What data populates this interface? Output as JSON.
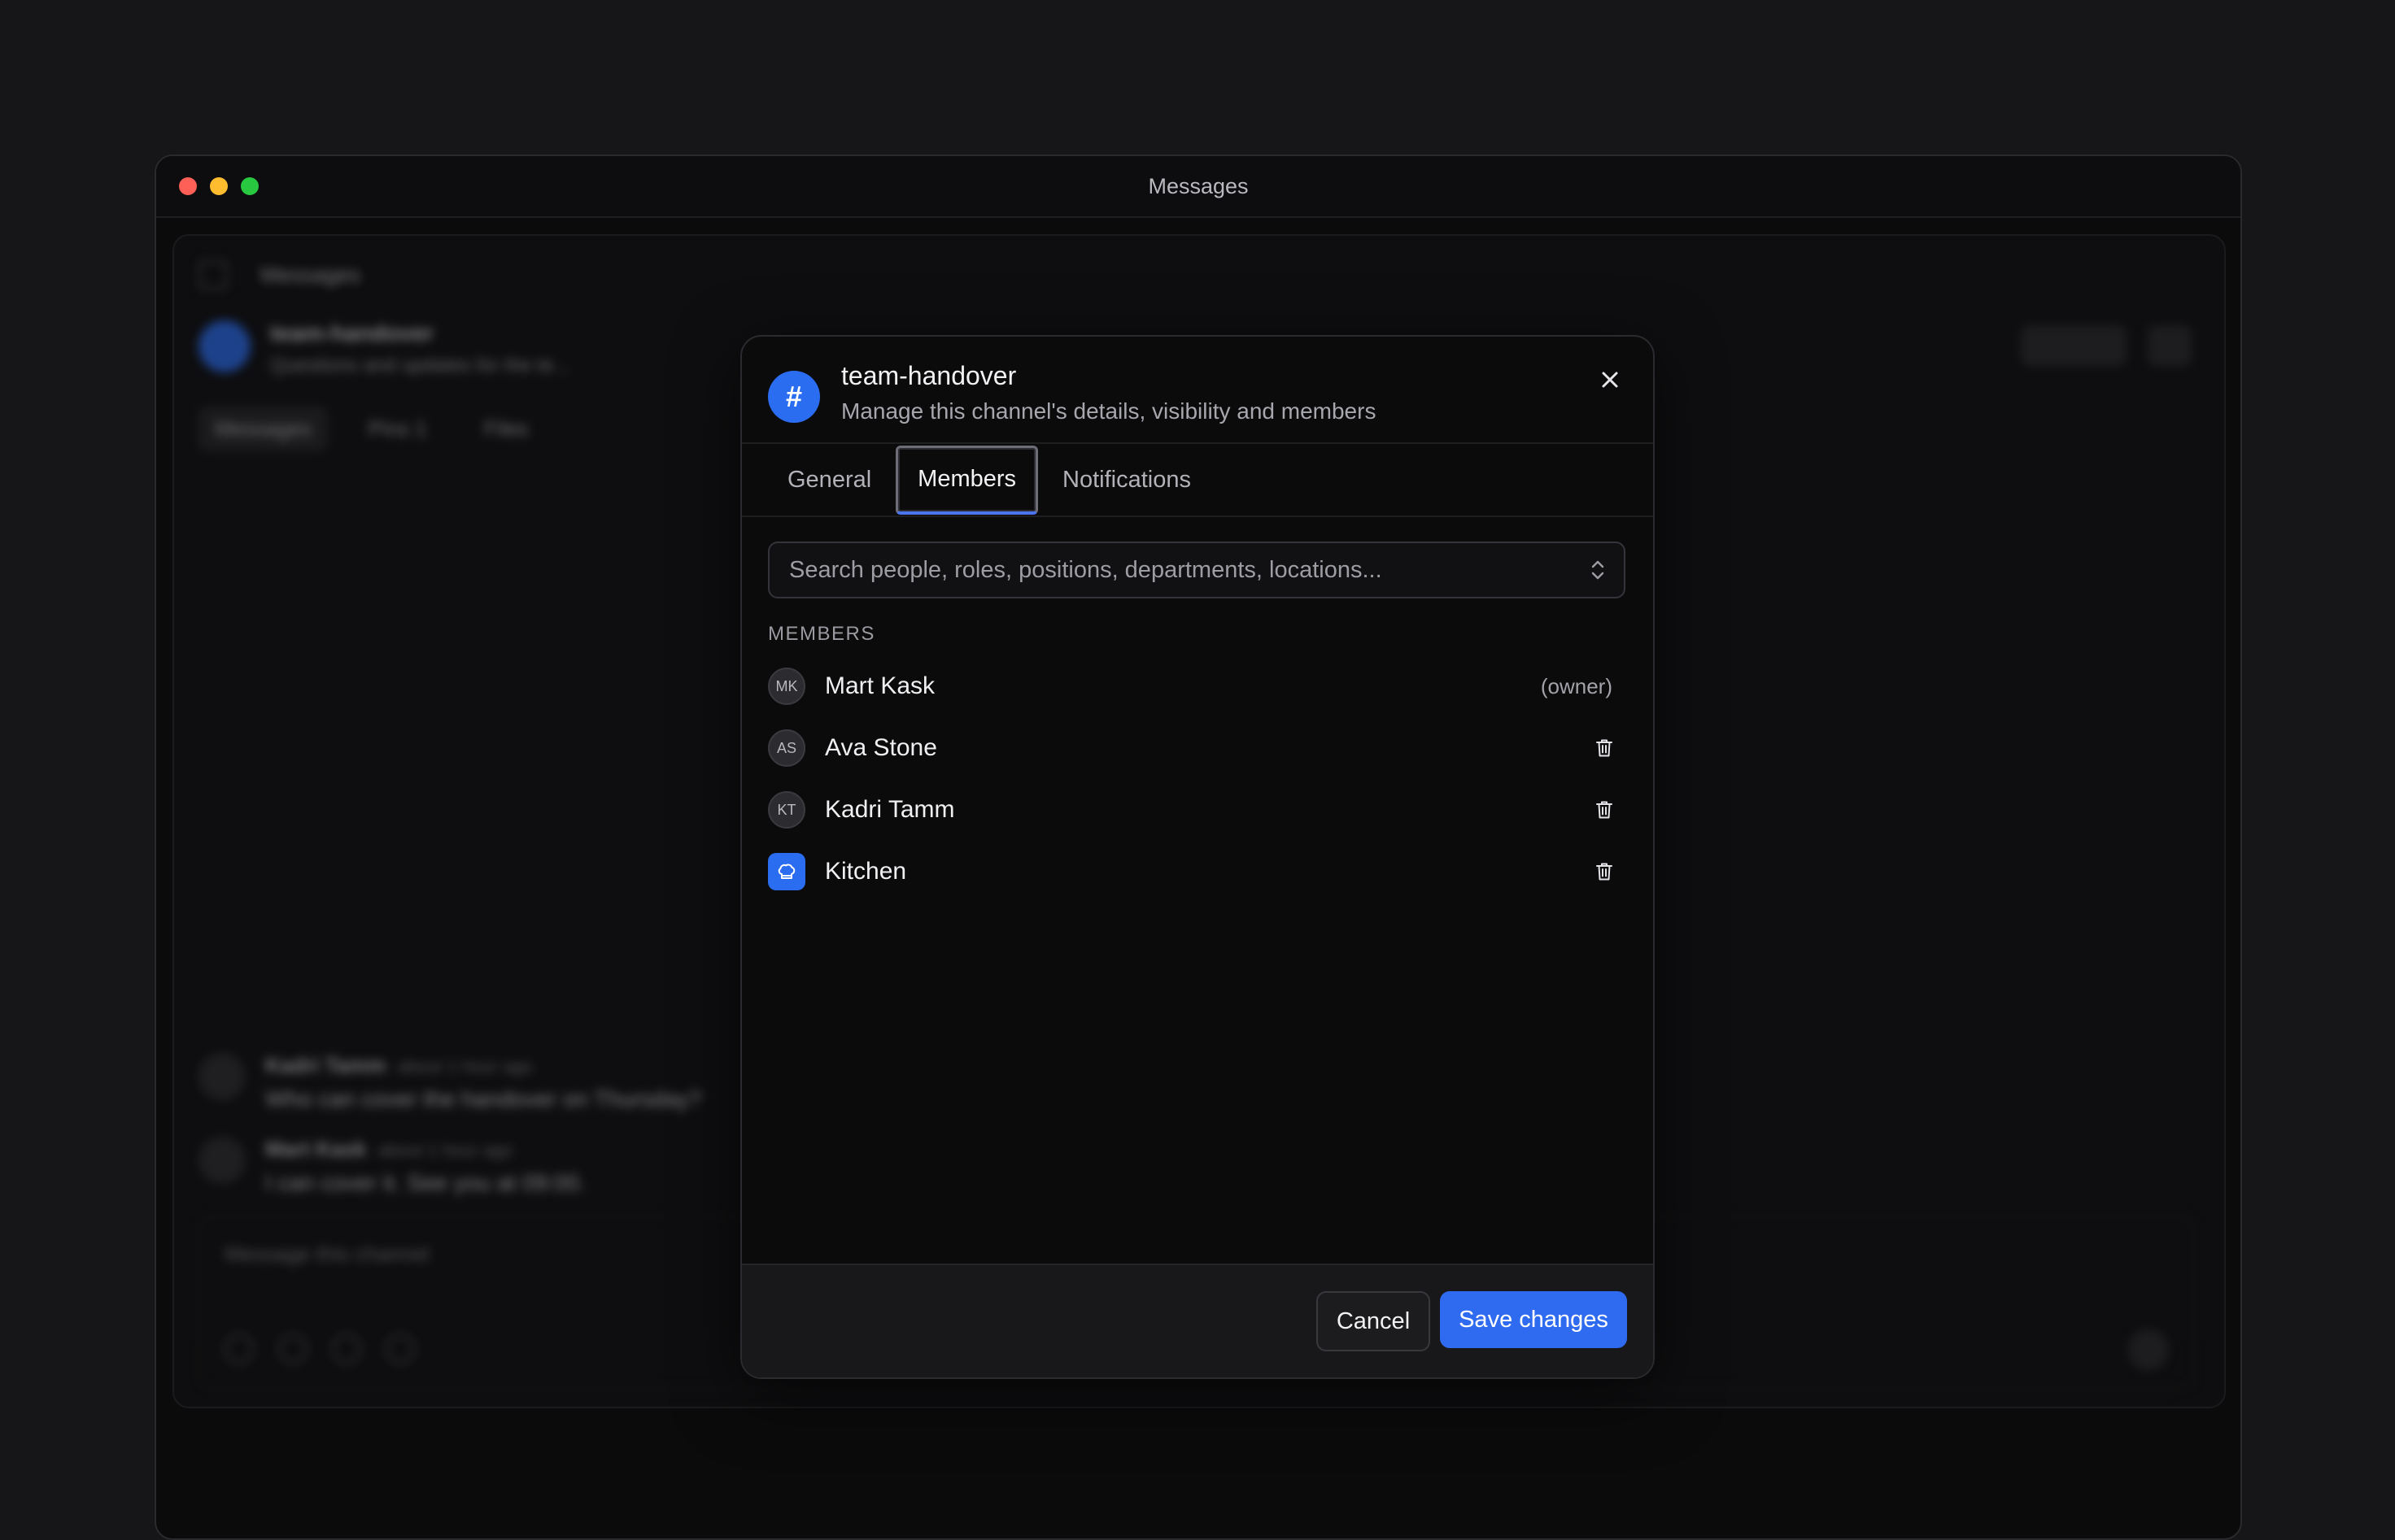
{
  "window": {
    "title": "Messages"
  },
  "background_app": {
    "breadcrumb": "Messages",
    "channel_name": "team-handover",
    "channel_desc": "Questions and updates for the te...",
    "tabs": [
      "Messages",
      "Pins 1",
      "Files"
    ],
    "messages": [
      {
        "author": "Kadri Tamm",
        "time": "about 1 hour ago",
        "text": "Who can cover the handover on Thursday?"
      },
      {
        "author": "Mart Kask",
        "time": "about 1 hour ago",
        "text": "I can cover it. See you at 09:00."
      }
    ],
    "composer_placeholder": "Message this channel"
  },
  "dialog": {
    "title": "team-handover",
    "subtitle": "Manage this channel's details, visibility and members",
    "channel_icon": "#",
    "tabs": [
      {
        "label": "General"
      },
      {
        "label": "Members",
        "active": true
      },
      {
        "label": "Notifications"
      }
    ],
    "search_placeholder": "Search people, roles, positions, departments, locations...",
    "section_label": "MEMBERS",
    "members": [
      {
        "initials": "MK",
        "name": "Mart Kask",
        "role": "(owner)"
      },
      {
        "initials": "AS",
        "name": "Ava Stone"
      },
      {
        "initials": "KT",
        "name": "Kadri Tamm"
      },
      {
        "icon": "chef-hat-icon",
        "name": "Kitchen"
      }
    ],
    "cancel_label": "Cancel",
    "save_label": "Save changes"
  },
  "colors": {
    "accent": "#2f6bf0",
    "background": "#0b0b0c"
  }
}
